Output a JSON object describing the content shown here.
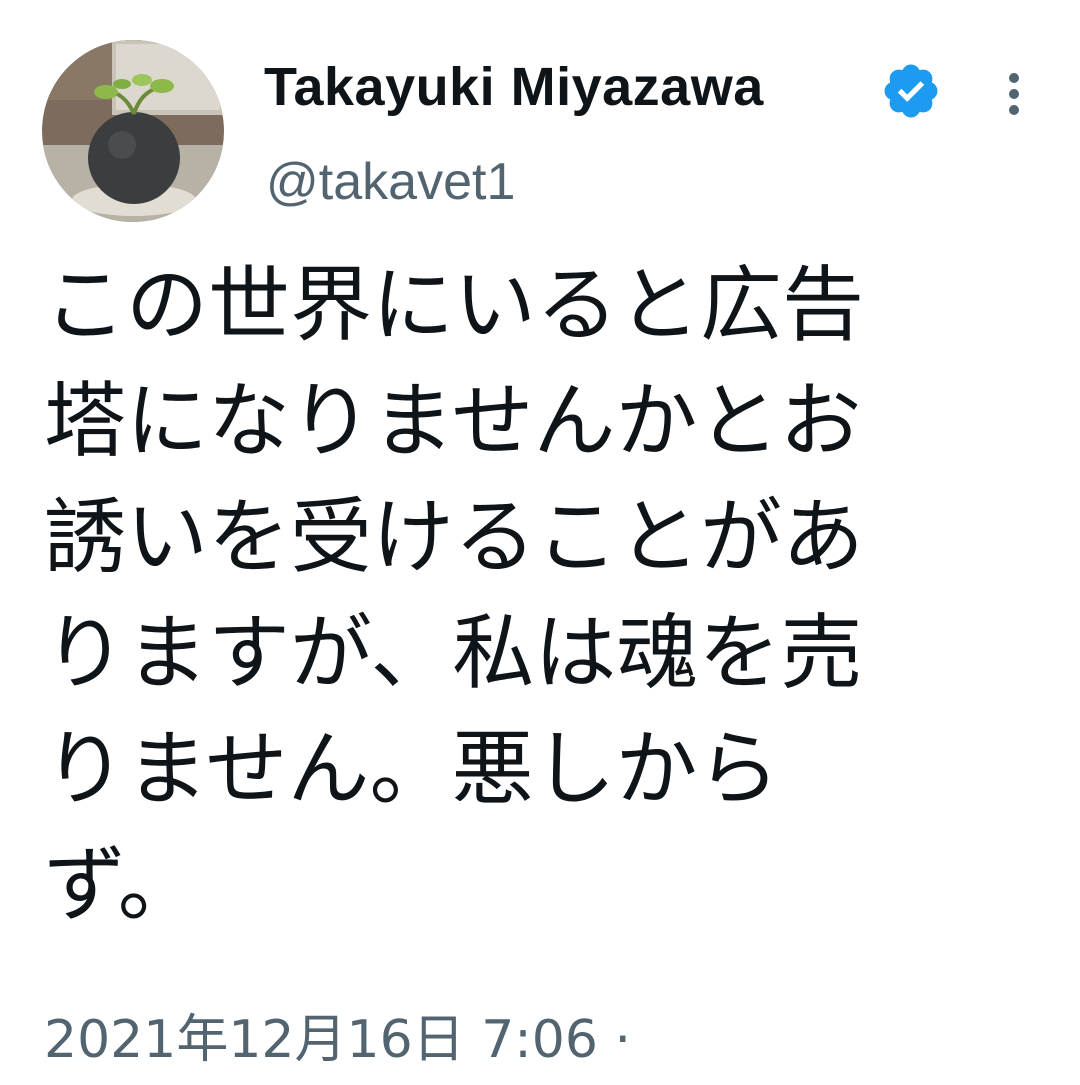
{
  "author": {
    "display_name": "Takayuki Miyazawa",
    "handle": "@takavet1",
    "verified_icon": "verified-badge-icon",
    "avatar": "avatar-photo-plant-pot"
  },
  "tweet": {
    "text": "この世界にいると広告\n塔になりませんかとお\n誘いを受けることがあ\nりますが、私は魂を売\nりません。悪しから\nず。",
    "timestamp": "2021年12月16日 7:06 ·"
  },
  "icons": {
    "more": "more-options-icon"
  },
  "colors": {
    "text": "#0f1419",
    "secondary_text": "#536471",
    "verified": "#1d9bf0",
    "background": "#ffffff"
  }
}
